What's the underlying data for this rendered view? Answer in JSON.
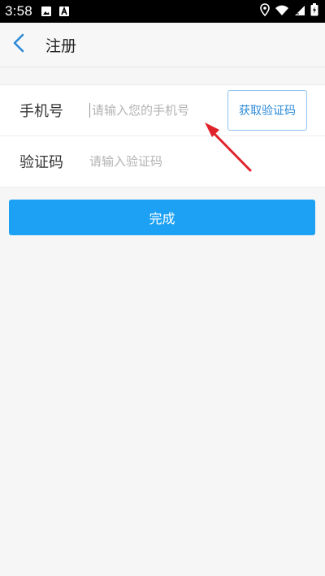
{
  "status_bar": {
    "time": "3:58",
    "icons": [
      "image-icon",
      "a-notification-icon",
      "location-icon",
      "wifi-icon",
      "signal-icon",
      "battery-charging-icon"
    ]
  },
  "header": {
    "title": "注册",
    "back_icon": "chevron-left-icon"
  },
  "form": {
    "phone": {
      "label": "手机号",
      "placeholder": "请输入您的手机号",
      "value": ""
    },
    "code": {
      "label": "验证码",
      "placeholder": "请输入验证码",
      "value": ""
    },
    "get_code_button": "获取验证码"
  },
  "submit_button": "完成",
  "colors": {
    "accent": "#1da1f5",
    "link": "#2b8ad8",
    "annotation_arrow": "#e0222a"
  }
}
